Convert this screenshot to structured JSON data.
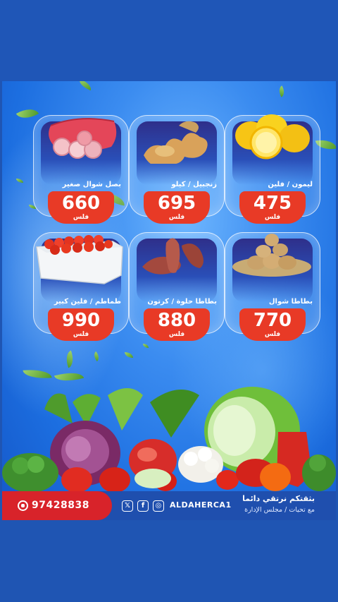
{
  "products": [
    {
      "name": "ليمون / فلين",
      "price": "475",
      "currency": "فلس",
      "icon": "lemon-icon"
    },
    {
      "name": "زنجبيل / كيلو",
      "price": "695",
      "currency": "فلس",
      "icon": "ginger-icon"
    },
    {
      "name": "بصل شوال صغير",
      "price": "660",
      "currency": "فلس",
      "icon": "onion-sack-icon"
    },
    {
      "name": "بطاطا شوال",
      "price": "770",
      "currency": "فلس",
      "icon": "potato-icon"
    },
    {
      "name": "بطاطا حلوة / كرتون",
      "price": "880",
      "currency": "فلس",
      "icon": "sweet-potato-icon"
    },
    {
      "name": "طماطم / فلين كبير",
      "price": "990",
      "currency": "فلس",
      "icon": "tomato-box-icon"
    }
  ],
  "footer": {
    "phone": "97428838",
    "handle": "ALDAHERCA1",
    "slogan": "بثقتكم نرتقي دائما",
    "sub_slogan": "مع تحيات / مجلس الإدارة"
  },
  "colors": {
    "accent": "#e83a26",
    "card_navy": "#2e2f8a",
    "background": "#1f55b3"
  }
}
